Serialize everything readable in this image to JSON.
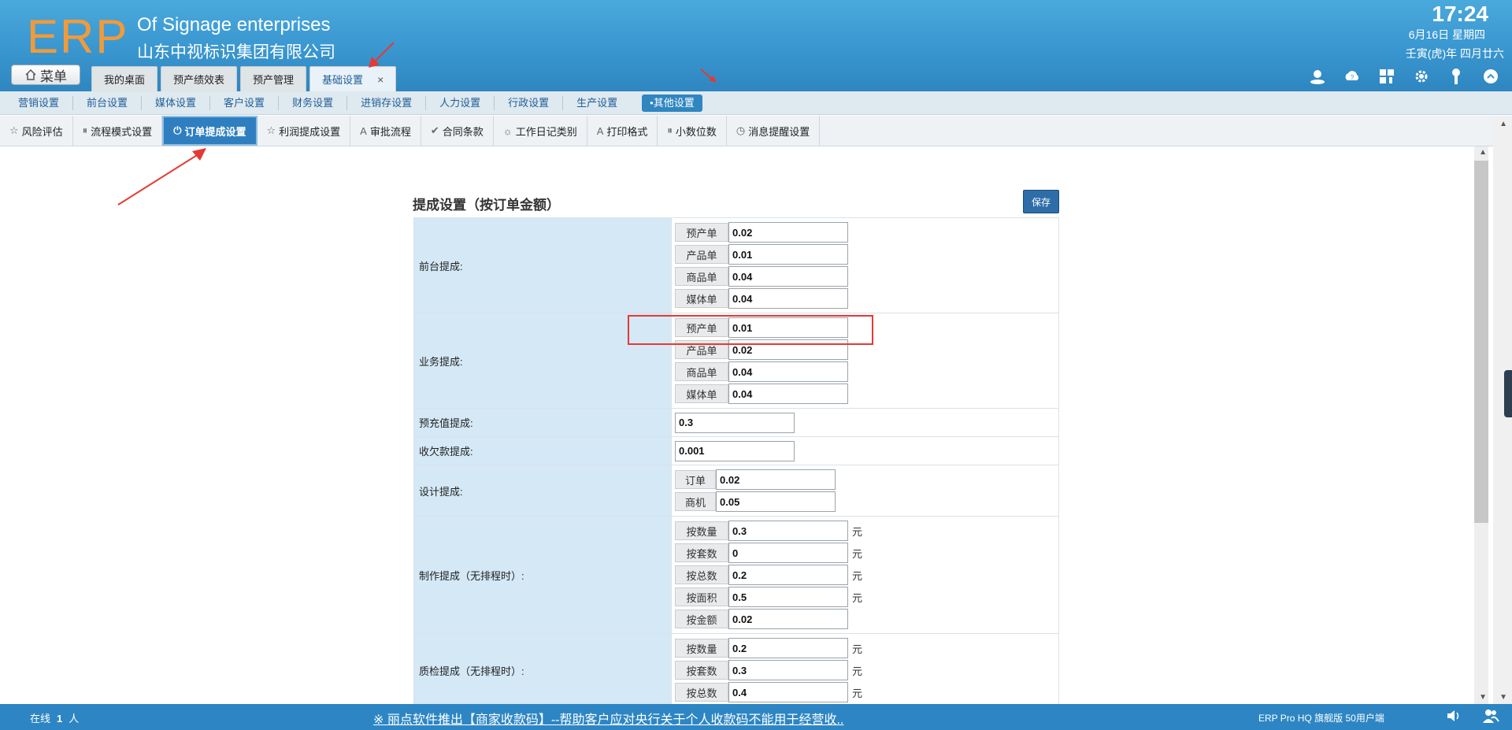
{
  "header": {
    "logo": "ERP",
    "company_en": "Of Signage enterprises",
    "company_cn": "山东中视标识集团有限公司",
    "time": "17:24",
    "date": "6月16日 星期四",
    "lunar": "壬寅(虎)年 四月廿六",
    "menu_label": "菜单",
    "tabs": [
      {
        "label": "我的桌面"
      },
      {
        "label": "预产绩效表"
      },
      {
        "label": "预产管理"
      },
      {
        "label": "基础设置",
        "close": "×"
      }
    ]
  },
  "categories": [
    "营销设置",
    "前台设置",
    "媒体设置",
    "客户设置",
    "财务设置",
    "进销存设置",
    "人力设置",
    "行政设置",
    "生产设置",
    "•其他设置"
  ],
  "sub_tabs": [
    {
      "label": "风险评估",
      "icon": "star-icon"
    },
    {
      "label": "流程模式设置",
      "icon": "pause-circle-icon"
    },
    {
      "label": "订单提成设置",
      "icon": "power-icon"
    },
    {
      "label": "利润提成设置",
      "icon": "star-icon"
    },
    {
      "label": "审批流程",
      "icon": "font-icon"
    },
    {
      "label": "合同条款",
      "icon": "check-icon"
    },
    {
      "label": "工作日记类别",
      "icon": "sun-icon"
    },
    {
      "label": "打印格式",
      "icon": "font-icon"
    },
    {
      "label": "小数位数",
      "icon": "pause-circle-icon"
    },
    {
      "label": "消息提醒设置",
      "icon": "clock-icon"
    }
  ],
  "panel": {
    "title": "提成设置（按订单金额）",
    "save_label": "保存",
    "rows": {
      "front": {
        "label": "前台提成:",
        "fields": [
          {
            "label": "预产单",
            "value": "0.02"
          },
          {
            "label": "产品单",
            "value": "0.01"
          },
          {
            "label": "商品单",
            "value": "0.04"
          },
          {
            "label": "媒体单",
            "value": "0.04"
          }
        ]
      },
      "business": {
        "label": "业务提成:",
        "fields": [
          {
            "label": "预产单",
            "value": "0.01"
          },
          {
            "label": "产品单",
            "value": "0.02"
          },
          {
            "label": "商品单",
            "value": "0.04"
          },
          {
            "label": "媒体单",
            "value": "0.04"
          }
        ]
      },
      "prepaid": {
        "label": "预充值提成:",
        "value": "0.3"
      },
      "arrears": {
        "label": "收欠款提成:",
        "value": "0.001"
      },
      "design": {
        "label": "设计提成:",
        "fields": [
          {
            "label": "订单",
            "value": "0.02"
          },
          {
            "label": "商机",
            "value": "0.05"
          }
        ]
      },
      "production": {
        "label": "制作提成（无排程时）:",
        "fields": [
          {
            "label": "按数量",
            "value": "0.3",
            "unit": "元"
          },
          {
            "label": "按套数",
            "value": "0",
            "unit": "元"
          },
          {
            "label": "按总数",
            "value": "0.2",
            "unit": "元"
          },
          {
            "label": "按面积",
            "value": "0.5",
            "unit": "元"
          },
          {
            "label": "按金额",
            "value": "0.02",
            "unit": ""
          }
        ]
      },
      "qc": {
        "label": "质检提成（无排程时）:",
        "fields": [
          {
            "label": "按数量",
            "value": "0.2",
            "unit": "元"
          },
          {
            "label": "按套数",
            "value": "0.3",
            "unit": "元"
          },
          {
            "label": "按总数",
            "value": "0.4",
            "unit": "元"
          }
        ]
      }
    }
  },
  "footer": {
    "online_prefix": "在线",
    "online_count": "1",
    "online_suffix": "人",
    "marquee": "※ 丽点软件推出【商家收款码】--帮助客户应对央行关于个人收款码不能用于经营收..",
    "version": "ERP Pro HQ 旗舰版 50用户端"
  },
  "colors": {
    "header": "#3996cf",
    "accent": "#2f7fc0",
    "logo": "#f29a3a",
    "annotation": "#e53935"
  }
}
